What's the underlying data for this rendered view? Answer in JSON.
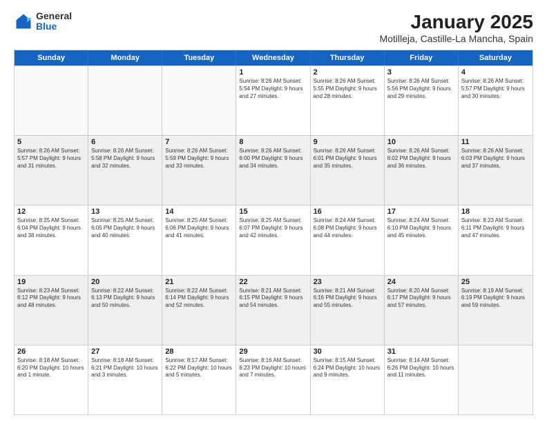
{
  "logo": {
    "general": "General",
    "blue": "Blue"
  },
  "title": "January 2025",
  "subtitle": "Motilleja, Castille-La Mancha, Spain",
  "header_days": [
    "Sunday",
    "Monday",
    "Tuesday",
    "Wednesday",
    "Thursday",
    "Friday",
    "Saturday"
  ],
  "weeks": [
    [
      {
        "day": "",
        "info": ""
      },
      {
        "day": "",
        "info": ""
      },
      {
        "day": "",
        "info": ""
      },
      {
        "day": "1",
        "info": "Sunrise: 8:26 AM\nSunset: 5:54 PM\nDaylight: 9 hours\nand 27 minutes."
      },
      {
        "day": "2",
        "info": "Sunrise: 8:26 AM\nSunset: 5:55 PM\nDaylight: 9 hours\nand 28 minutes."
      },
      {
        "day": "3",
        "info": "Sunrise: 8:26 AM\nSunset: 5:56 PM\nDaylight: 9 hours\nand 29 minutes."
      },
      {
        "day": "4",
        "info": "Sunrise: 8:26 AM\nSunset: 5:57 PM\nDaylight: 9 hours\nand 30 minutes."
      }
    ],
    [
      {
        "day": "5",
        "info": "Sunrise: 8:26 AM\nSunset: 5:57 PM\nDaylight: 9 hours\nand 31 minutes."
      },
      {
        "day": "6",
        "info": "Sunrise: 8:26 AM\nSunset: 5:58 PM\nDaylight: 9 hours\nand 32 minutes."
      },
      {
        "day": "7",
        "info": "Sunrise: 8:26 AM\nSunset: 5:59 PM\nDaylight: 9 hours\nand 33 minutes."
      },
      {
        "day": "8",
        "info": "Sunrise: 8:26 AM\nSunset: 6:00 PM\nDaylight: 9 hours\nand 34 minutes."
      },
      {
        "day": "9",
        "info": "Sunrise: 8:26 AM\nSunset: 6:01 PM\nDaylight: 9 hours\nand 35 minutes."
      },
      {
        "day": "10",
        "info": "Sunrise: 8:26 AM\nSunset: 6:02 PM\nDaylight: 9 hours\nand 36 minutes."
      },
      {
        "day": "11",
        "info": "Sunrise: 8:26 AM\nSunset: 6:03 PM\nDaylight: 9 hours\nand 37 minutes."
      }
    ],
    [
      {
        "day": "12",
        "info": "Sunrise: 8:25 AM\nSunset: 6:04 PM\nDaylight: 9 hours\nand 38 minutes."
      },
      {
        "day": "13",
        "info": "Sunrise: 8:25 AM\nSunset: 6:05 PM\nDaylight: 9 hours\nand 40 minutes."
      },
      {
        "day": "14",
        "info": "Sunrise: 8:25 AM\nSunset: 6:06 PM\nDaylight: 9 hours\nand 41 minutes."
      },
      {
        "day": "15",
        "info": "Sunrise: 8:25 AM\nSunset: 6:07 PM\nDaylight: 9 hours\nand 42 minutes."
      },
      {
        "day": "16",
        "info": "Sunrise: 8:24 AM\nSunset: 6:08 PM\nDaylight: 9 hours\nand 44 minutes."
      },
      {
        "day": "17",
        "info": "Sunrise: 8:24 AM\nSunset: 6:10 PM\nDaylight: 9 hours\nand 45 minutes."
      },
      {
        "day": "18",
        "info": "Sunrise: 8:23 AM\nSunset: 6:11 PM\nDaylight: 9 hours\nand 47 minutes."
      }
    ],
    [
      {
        "day": "19",
        "info": "Sunrise: 8:23 AM\nSunset: 6:12 PM\nDaylight: 9 hours\nand 48 minutes."
      },
      {
        "day": "20",
        "info": "Sunrise: 8:22 AM\nSunset: 6:13 PM\nDaylight: 9 hours\nand 50 minutes."
      },
      {
        "day": "21",
        "info": "Sunrise: 8:22 AM\nSunset: 6:14 PM\nDaylight: 9 hours\nand 52 minutes."
      },
      {
        "day": "22",
        "info": "Sunrise: 8:21 AM\nSunset: 6:15 PM\nDaylight: 9 hours\nand 54 minutes."
      },
      {
        "day": "23",
        "info": "Sunrise: 8:21 AM\nSunset: 6:16 PM\nDaylight: 9 hours\nand 55 minutes."
      },
      {
        "day": "24",
        "info": "Sunrise: 8:20 AM\nSunset: 6:17 PM\nDaylight: 9 hours\nand 57 minutes."
      },
      {
        "day": "25",
        "info": "Sunrise: 8:19 AM\nSunset: 6:19 PM\nDaylight: 9 hours\nand 59 minutes."
      }
    ],
    [
      {
        "day": "26",
        "info": "Sunrise: 8:18 AM\nSunset: 6:20 PM\nDaylight: 10 hours\nand 1 minute."
      },
      {
        "day": "27",
        "info": "Sunrise: 8:18 AM\nSunset: 6:21 PM\nDaylight: 10 hours\nand 3 minutes."
      },
      {
        "day": "28",
        "info": "Sunrise: 8:17 AM\nSunset: 6:22 PM\nDaylight: 10 hours\nand 5 minutes."
      },
      {
        "day": "29",
        "info": "Sunrise: 8:16 AM\nSunset: 6:23 PM\nDaylight: 10 hours\nand 7 minutes."
      },
      {
        "day": "30",
        "info": "Sunrise: 8:15 AM\nSunset: 6:24 PM\nDaylight: 10 hours\nand 9 minutes."
      },
      {
        "day": "31",
        "info": "Sunrise: 8:14 AM\nSunset: 6:26 PM\nDaylight: 10 hours\nand 11 minutes."
      },
      {
        "day": "",
        "info": ""
      }
    ]
  ],
  "shaded_rows": [
    1,
    3
  ],
  "accent_color": "#1565c0"
}
